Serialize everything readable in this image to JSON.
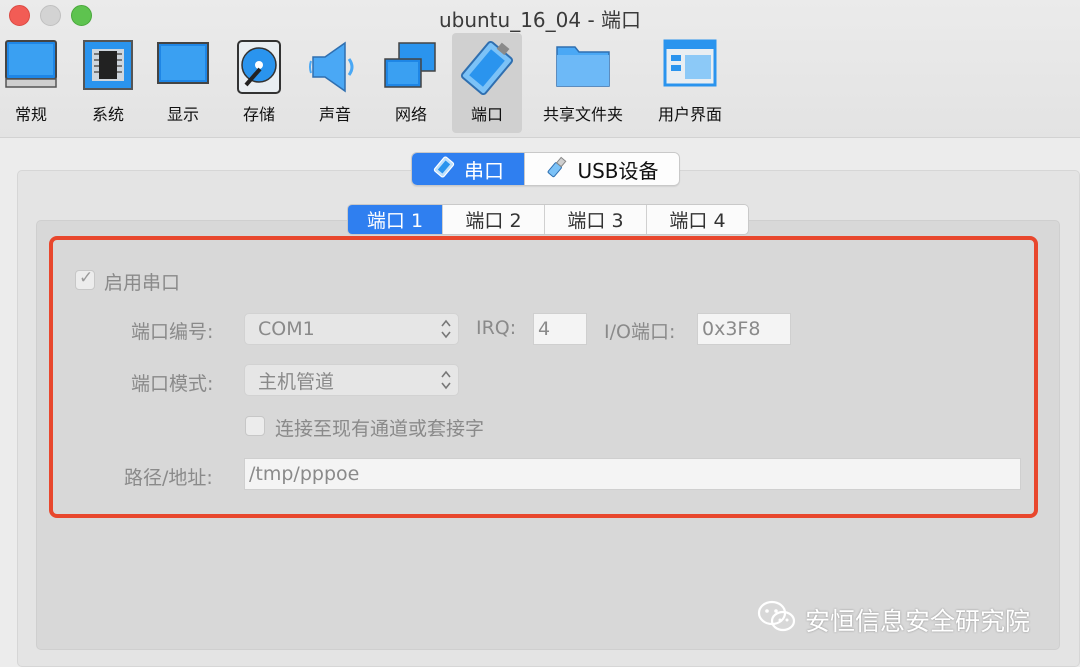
{
  "window": {
    "title": "ubuntu_16_04 - 端口"
  },
  "toolbar": {
    "items": [
      {
        "label": "常规",
        "icon": "monitor-icon"
      },
      {
        "label": "系统",
        "icon": "chip-icon"
      },
      {
        "label": "显示",
        "icon": "display-icon"
      },
      {
        "label": "存储",
        "icon": "disk-icon"
      },
      {
        "label": "声音",
        "icon": "speaker-icon"
      },
      {
        "label": "网络",
        "icon": "network-icon"
      },
      {
        "label": "端口",
        "icon": "port-connector-icon"
      },
      {
        "label": "共享文件夹",
        "icon": "folder-icon"
      },
      {
        "label": "用户界面",
        "icon": "window-layout-icon"
      }
    ],
    "active": "端口"
  },
  "segments": {
    "serial": "串口",
    "usb": "USB设备"
  },
  "port_tabs": [
    "端口 1",
    "端口 2",
    "端口 3",
    "端口 4"
  ],
  "form": {
    "enable_label": "启用串口",
    "enabled": true,
    "port_number_label": "端口编号:",
    "port_number_value": "COM1",
    "irq_label": "IRQ:",
    "irq_value": "4",
    "io_label": "I/O端口:",
    "io_value": "0x3F8",
    "mode_label": "端口模式:",
    "mode_value": "主机管道",
    "connect_existing_label": "连接至现有通道或套接字",
    "connect_existing": false,
    "path_label": "路径/地址:",
    "path_value": "/tmp/pppoe"
  },
  "watermark": {
    "text": "安恒信息安全研究院",
    "icon": "wechat-icon"
  },
  "colors": {
    "accent": "#2f7ff0",
    "highlight_box": "#e8472d"
  }
}
